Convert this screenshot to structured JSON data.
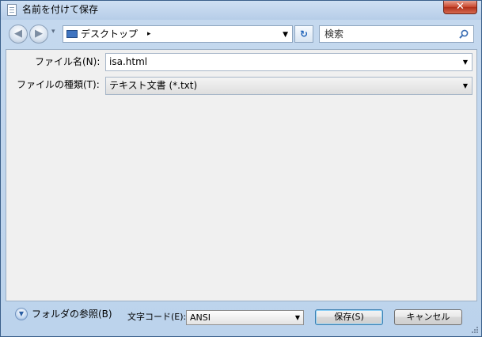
{
  "window": {
    "title": "名前を付けて保存",
    "close_glyph": "✕"
  },
  "nav": {
    "back_glyph": "◀",
    "forward_glyph": "▶",
    "history_glyph": "▾",
    "address": "デスクトップ",
    "address_chevron": "▸",
    "address_drop": "▼",
    "refresh_glyph": "↻",
    "search_placeholder": "検索"
  },
  "form": {
    "filename_label": "ファイル名(N):",
    "filename_value": "isa.html",
    "filetype_label": "ファイルの種類(T):",
    "filetype_value": "テキスト文書 (*.txt)",
    "drop_glyph": "▼"
  },
  "footer": {
    "browse_folders": "フォルダの参照(B)",
    "toggle_glyph": "▼",
    "encoding_label": "文字コード(E):",
    "encoding_value": "ANSI",
    "save_button": "保存(S)",
    "cancel_button": "キャンセル"
  },
  "icons": {
    "title": "notepad-icon",
    "address": "desktop-icon",
    "search": "search-icon"
  },
  "colors": {
    "titlebar": "#b6cde8",
    "close_button": "#c8452b",
    "pane": "#f0f0f0",
    "default_button_border": "#3c7fb1"
  }
}
